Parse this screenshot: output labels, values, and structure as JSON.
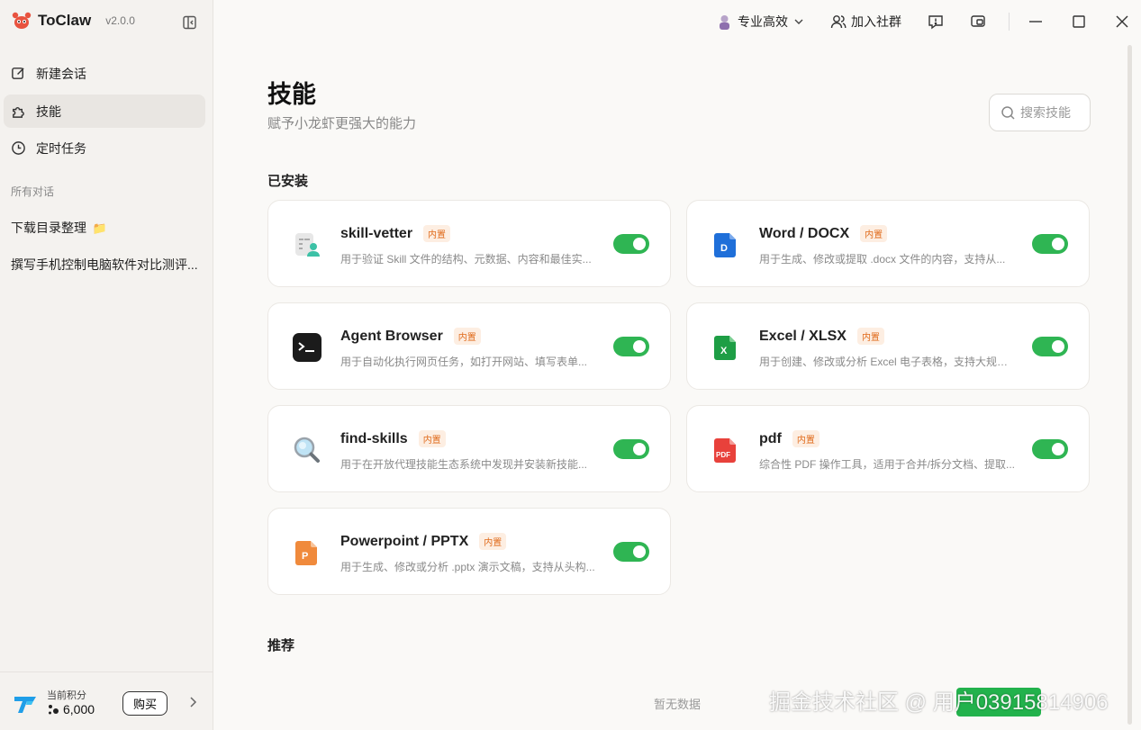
{
  "app": {
    "name": "ToClaw",
    "version": "v2.0.0"
  },
  "sidebar": {
    "nav": [
      {
        "label": "新建会话",
        "icon": "edit-icon"
      },
      {
        "label": "技能",
        "icon": "puzzle-icon"
      },
      {
        "label": "定时任务",
        "icon": "clock-icon"
      }
    ],
    "section_label": "所有对话",
    "conversations": [
      {
        "title": "下载目录整理",
        "emoji": "📁"
      },
      {
        "title": "撰写手机控制电脑软件对比测评..."
      }
    ],
    "points": {
      "label": "当前积分",
      "value": "6,000",
      "buy_label": "购买"
    }
  },
  "topbar": {
    "mode_label": "专业高效",
    "community_label": "加入社群"
  },
  "main": {
    "title": "技能",
    "subtitle": "赋予小龙虾更强大的能力",
    "search_placeholder": "搜索技能",
    "installed_label": "已安装",
    "recommended_label": "推荐",
    "empty_text": "暂无数据",
    "skills": [
      {
        "name": "skill-vetter",
        "badge": "内置",
        "desc": "用于验证 Skill 文件的结构、元数据、内容和最佳实...",
        "enabled": true,
        "icon": "document-check-icon"
      },
      {
        "name": "Word / DOCX",
        "badge": "内置",
        "desc": "用于生成、修改或提取 .docx 文件的内容，支持从...",
        "enabled": true,
        "icon": "word-icon"
      },
      {
        "name": "Agent Browser",
        "badge": "内置",
        "desc": "用于自动化执行网页任务，如打开网站、填写表单...",
        "enabled": true,
        "icon": "terminal-icon"
      },
      {
        "name": "Excel / XLSX",
        "badge": "内置",
        "desc": "用于创建、修改或分析 Excel 电子表格，支持大规模...",
        "enabled": true,
        "icon": "excel-icon"
      },
      {
        "name": "find-skills",
        "badge": "内置",
        "desc": "用于在开放代理技能生态系统中发现并安装新技能...",
        "enabled": true,
        "icon": "magnifier-icon"
      },
      {
        "name": "pdf",
        "badge": "内置",
        "desc": "综合性 PDF 操作工具，适用于合并/拆分文档、提取...",
        "enabled": true,
        "icon": "pdf-icon"
      },
      {
        "name": "Powerpoint / PPTX",
        "badge": "内置",
        "desc": "用于生成、修改或分析 .pptx 演示文稿，支持从头构...",
        "enabled": true,
        "icon": "powerpoint-icon"
      }
    ]
  },
  "watermark": "掘金技术社区 @ 用户03915814906"
}
